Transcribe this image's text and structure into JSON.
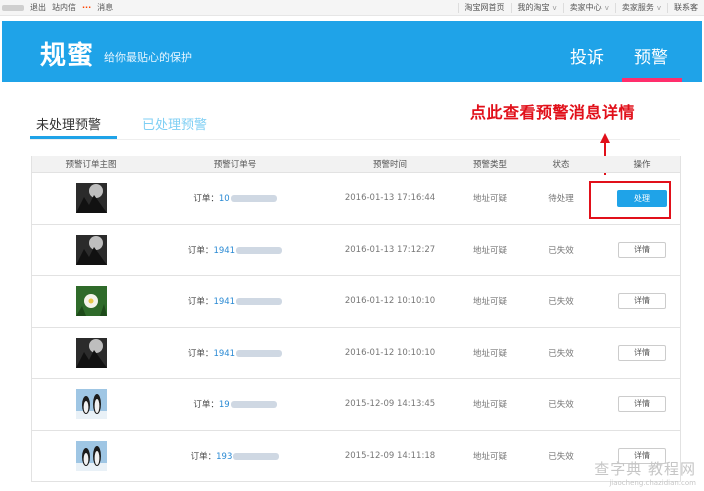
{
  "topbar": {
    "logout": "退出",
    "messages_site": "站内信",
    "messages": "消息",
    "nav": [
      {
        "label": "淘宝网首页",
        "dropdown": false
      },
      {
        "label": "我的淘宝",
        "dropdown": true
      },
      {
        "label": "卖家中心",
        "dropdown": true
      },
      {
        "label": "卖家服务",
        "dropdown": true
      },
      {
        "label": "联系客",
        "dropdown": false
      }
    ]
  },
  "header": {
    "brand": "规蜜",
    "slogan": "给你最贴心的保护",
    "nav_complain": "投诉",
    "nav_warning": "预警",
    "bg_color": "#1fa3e8",
    "active_underline_color": "#ff2e6c"
  },
  "tabs": {
    "active": "未处理预警",
    "inactive": "已处理预警"
  },
  "annotation": {
    "text": "点此查看预警消息详情",
    "color": "#e1101a"
  },
  "table": {
    "headers": [
      "预警订单主图",
      "预警订单号",
      "预警时间",
      "预警类型",
      "状态",
      "操作"
    ],
    "order_label": "订单：",
    "rows": [
      {
        "thumb": "thumb-dark-scene",
        "order_prefix": "10",
        "time": "2016-01-13 17:16:44",
        "type": "地址可疑",
        "status": "待处理",
        "action": "处理"
      },
      {
        "thumb": "thumb-dark-scene",
        "order_prefix": "1941",
        "time": "2016-01-13 17:12:27",
        "type": "地址可疑",
        "status": "已失效",
        "action": "详情"
      },
      {
        "thumb": "thumb-flower",
        "order_prefix": "1941",
        "time": "2016-01-12 10:10:10",
        "type": "地址可疑",
        "status": "已失效",
        "action": "详情"
      },
      {
        "thumb": "thumb-dark-scene",
        "order_prefix": "1941",
        "time": "2016-01-12 10:10:10",
        "type": "地址可疑",
        "status": "已失效",
        "action": "详情"
      },
      {
        "thumb": "thumb-penguins",
        "order_prefix": "19",
        "time": "2015-12-09 14:13:45",
        "type": "地址可疑",
        "status": "已失效",
        "action": "详情"
      },
      {
        "thumb": "thumb-penguins",
        "order_prefix": "193",
        "time": "2015-12-09 14:11:18",
        "type": "地址可疑",
        "status": "已失效",
        "action": "详情"
      }
    ]
  },
  "watermark": {
    "line1": "查字典 教程网",
    "line2": "jiaocheng.chazidian.com"
  }
}
